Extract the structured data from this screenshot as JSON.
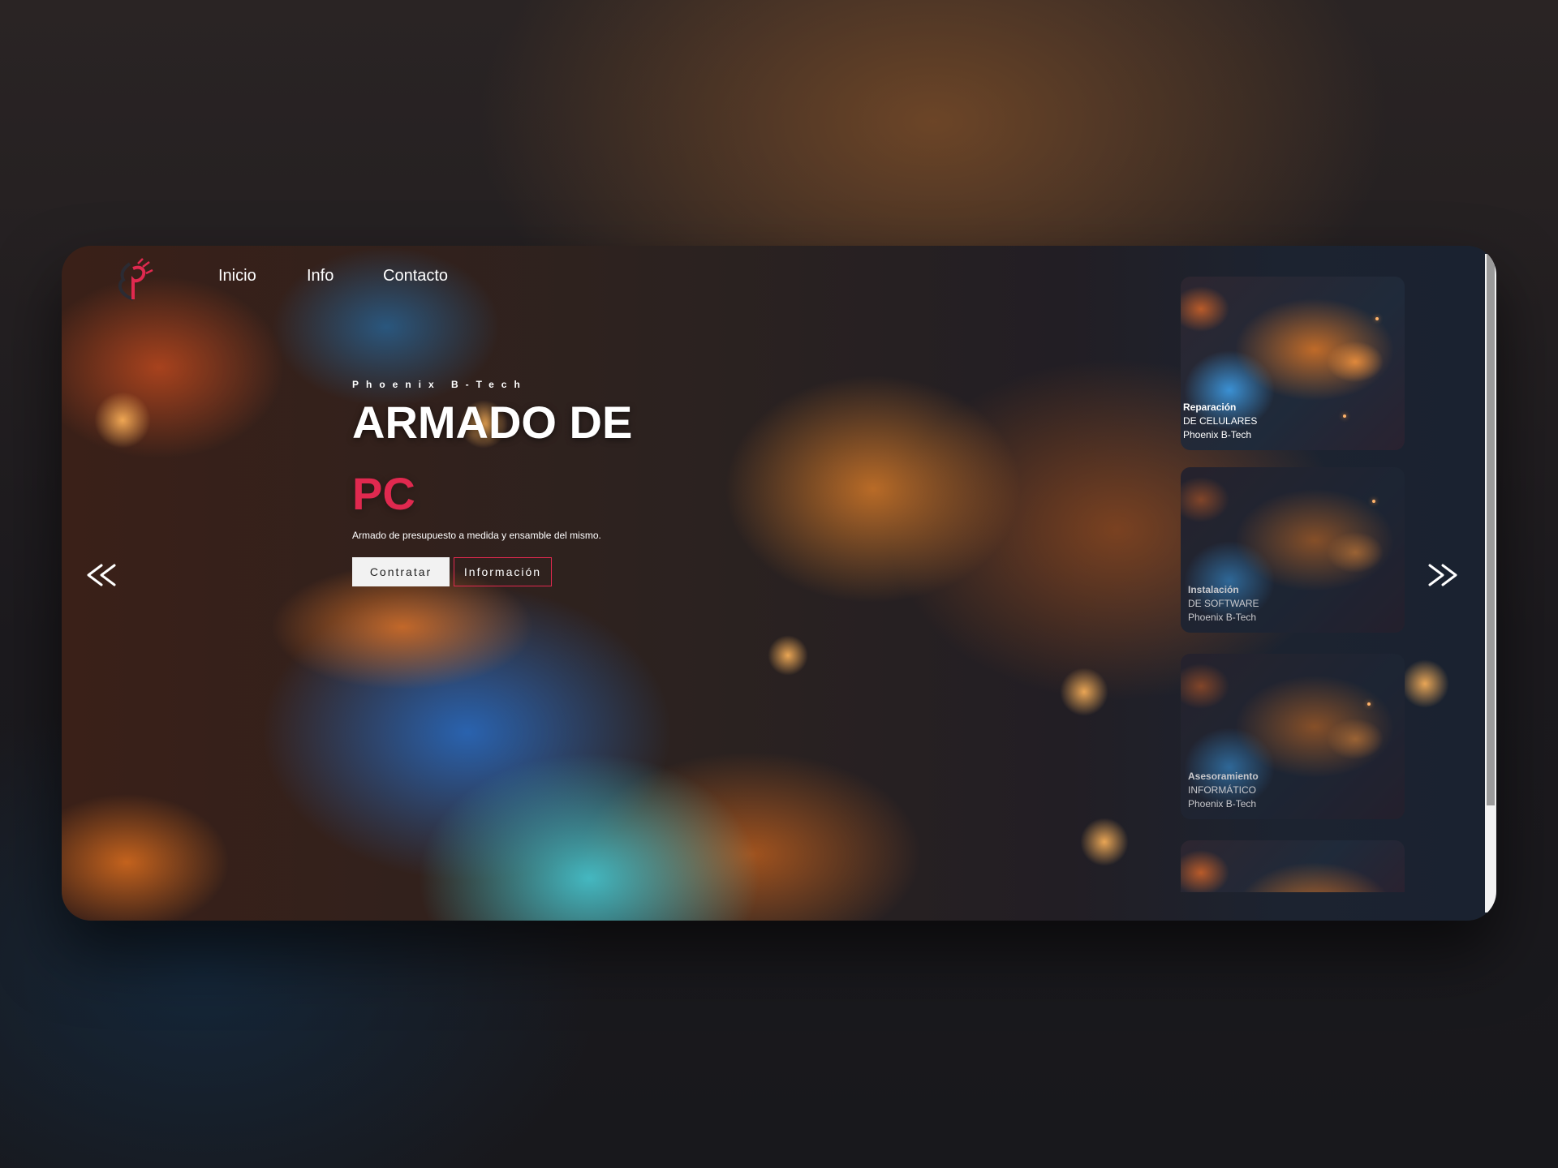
{
  "nav": {
    "logo_alt": "phoenix-logo",
    "items": [
      "Inicio",
      "Info",
      "Contacto"
    ]
  },
  "hero": {
    "eyebrow": "Phoenix B-Tech",
    "headline": "ARMADO DE",
    "headline_accent": "PC",
    "subtitle": "Armado de presupuesto a medida y ensamble del mismo.",
    "primary_button": "Contratar",
    "secondary_button": "Información"
  },
  "carousel": {
    "prev_icon": "double-chevron-left-icon",
    "next_icon": "double-chevron-right-icon",
    "cards": [
      {
        "title": "Reparación",
        "subtitle": "DE CELULARES",
        "brand": "Phoenix B-Tech"
      },
      {
        "title": "Instalación",
        "subtitle": "DE SOFTWARE",
        "brand": "Phoenix B-Tech"
      },
      {
        "title": "Asesoramiento",
        "subtitle": "INFORMÁTICO",
        "brand": "Phoenix B-Tech"
      }
    ]
  },
  "colors": {
    "accent": "#e0294f",
    "text": "#ffffff",
    "primary_button_bg": "#f2f2f2"
  }
}
